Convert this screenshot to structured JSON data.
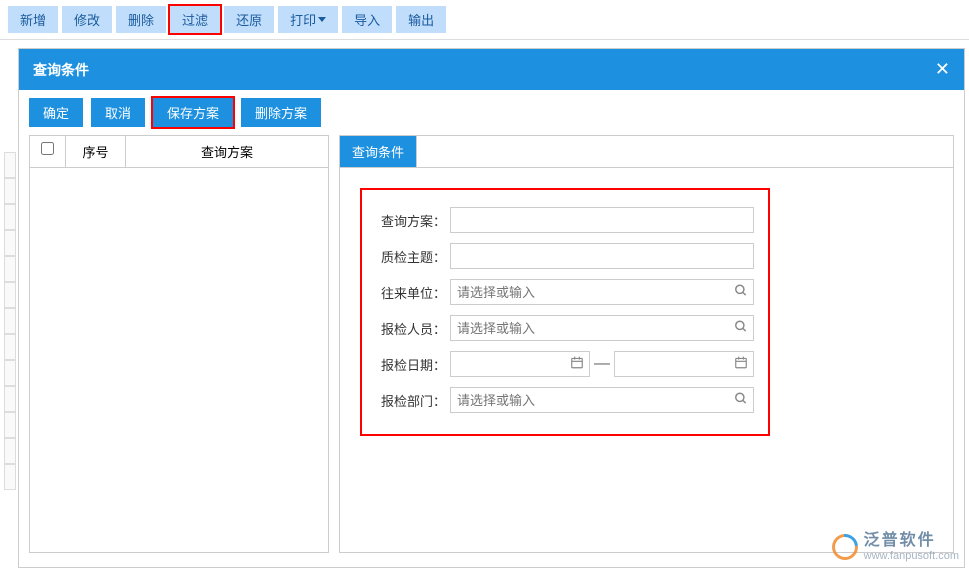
{
  "toolbar": {
    "add": "新增",
    "edit": "修改",
    "delete": "删除",
    "filter": "过滤",
    "restore": "还原",
    "print": "打印",
    "import": "导入",
    "export": "输出"
  },
  "modal": {
    "title": "查询条件",
    "actions": {
      "ok": "确定",
      "cancel": "取消",
      "save_plan": "保存方案",
      "delete_plan": "删除方案"
    },
    "table": {
      "col_seq": "序号",
      "col_plan": "查询方案"
    },
    "tab": "查询条件",
    "form": {
      "plan_label": "查询方案：",
      "plan_value": "",
      "subject_label": "质检主题：",
      "subject_value": "",
      "unit_label": "往来单位：",
      "unit_placeholder": "请选择或输入",
      "inspector_label": "报检人员：",
      "inspector_placeholder": "请选择或输入",
      "date_label": "报检日期：",
      "date_from": "",
      "date_to": "",
      "date_sep": "—",
      "dept_label": "报检部门：",
      "dept_placeholder": "请选择或输入"
    }
  },
  "watermark": {
    "title": "泛普软件",
    "url": "www.fanpusoft.com"
  }
}
